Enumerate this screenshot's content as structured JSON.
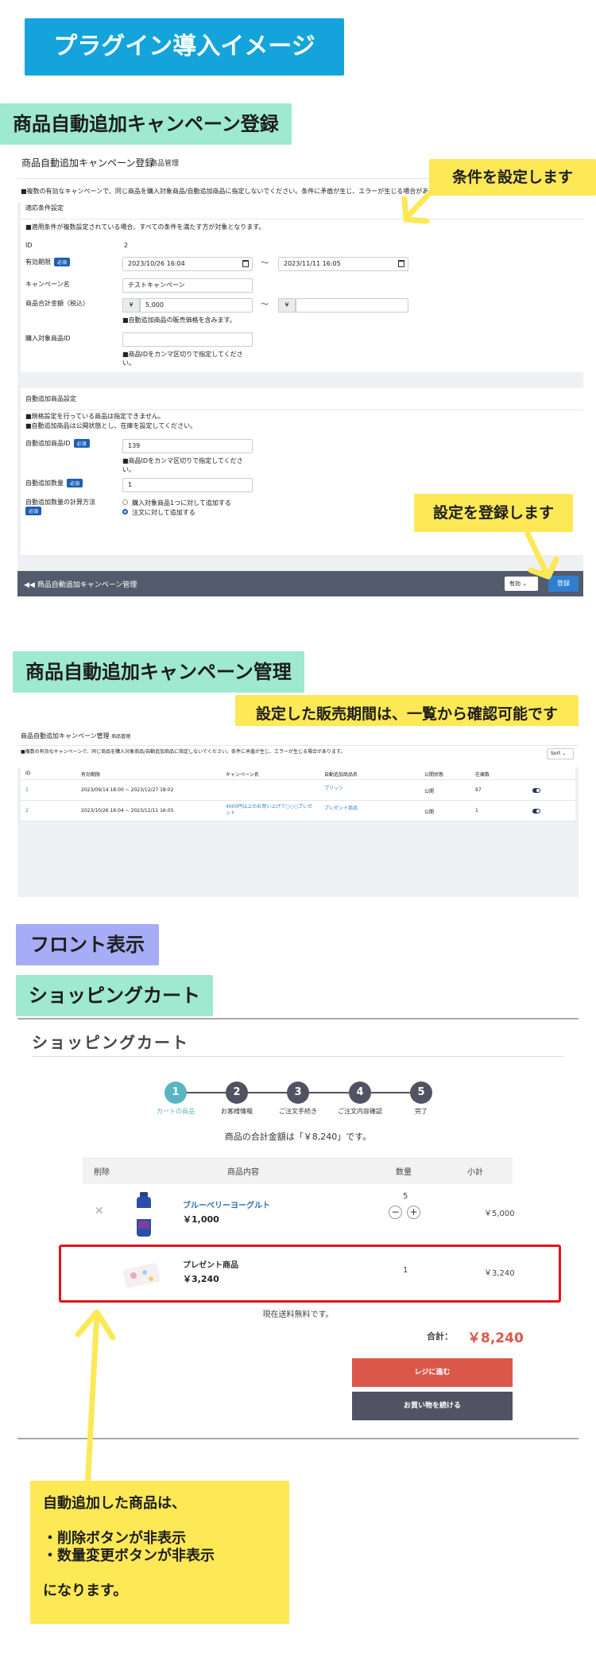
{
  "top_banner": "プラグイン導入イメージ",
  "section1": {
    "banner": "商品自動追加キャンペーン登録",
    "note_condition": "条件を設定します",
    "note_register": "設定を登録します",
    "admin": {
      "title": "商品自動追加キャンペーン登録",
      "subtitle": "商品管理",
      "warning": "■複数の有効なキャンペーンで、同じ商品を購入対象商品/自動追加商品に指定しないでください。条件に矛盾が生じ、エラーが生じる場合があります。",
      "panel1": {
        "title": "適応条件設定",
        "note": "■適用条件が複数設定されている場合、すべての条件を満たす方が対象となります。",
        "id_label": "ID",
        "id_value": "2",
        "period_label": "有効期限",
        "required": "必須",
        "period_start": "2023/10/26 16:04",
        "tilde": "〜",
        "period_end": "2023/11/11 16:05",
        "campaign_label": "キャンペーン名",
        "campaign_value": "テストキャンペーン",
        "total_label": "商品合計金額（税込）",
        "yen": "¥",
        "total_min": "5,000",
        "total_note": "■自動追加商品の販売価格を含みます。",
        "target_label": "購入対象商品ID",
        "target_note": "■商品IDをカンマ区切りで指定してくださ い。"
      },
      "panel2": {
        "title": "自動追加商品設定",
        "note1": "■規格設定を行っている商品は指定できません。",
        "note2": "■自動追加商品は公開状態とし、在庫を設定してください。",
        "product_id_label": "自動追加商品ID",
        "product_id_value": "139",
        "product_id_note": "■商品IDをカンマ区切りで指定してくださ い。",
        "qty_label": "自動追加数量",
        "qty_value": "1",
        "method_label": "自動追加数量の計算方法",
        "method_opt1": "購入対象商品1つに対して追加する",
        "method_opt2": "注文に対して追加する"
      },
      "footer": {
        "back_link": "◀◀ 商品自動追加キャンペーン管理",
        "status": "有効 ⌄",
        "register_btn": "登録"
      }
    }
  },
  "section2": {
    "banner": "商品自動追加キャンペーン管理",
    "note": "設定した販売期間は、一覧から確認可能です",
    "admin": {
      "title": "商品自動追加キャンペーン管理",
      "subtitle": "商品管理",
      "warning": "■複数の有効なキャンペーンで、同じ商品を購入対象商品/自動追加商品に指定しないでください。条件に矛盾が生じ、エラーが生じる場合があります。",
      "sort": "Sort ⌄",
      "headers": [
        "ID",
        "有効期限",
        "キャンペーン名",
        "自動追加商品名",
        "公開状態",
        "在庫数"
      ],
      "rows": [
        {
          "id": "1",
          "period": "2023/09/14 18:00 ~ 2023/12/27 18:02",
          "campaign": "",
          "product": "プリッツ",
          "status": "公開",
          "stock": "97"
        },
        {
          "id": "2",
          "period": "2023/10/26 16:04 ~ 2023/11/11 16:05",
          "campaign": "4000円以上のお買い上げで○○○プレゼント",
          "product": "プレゼント商品",
          "status": "公開",
          "stock": "1"
        }
      ]
    }
  },
  "section3": {
    "front_banner": "フロント表示",
    "cart_banner": "ショッピングカート",
    "cart": {
      "title": "ショッピングカート",
      "steps": [
        {
          "num": "1",
          "label": "カートの商品"
        },
        {
          "num": "2",
          "label": "お客様情報"
        },
        {
          "num": "3",
          "label": "ご注文手続き"
        },
        {
          "num": "4",
          "label": "ご注文内容確認"
        },
        {
          "num": "5",
          "label": "完了"
        }
      ],
      "total_message": "商品の合計金額は「￥8,240」です。",
      "headers": {
        "delete": "削除",
        "content": "商品内容",
        "qty": "数量",
        "subtotal": "小計"
      },
      "items": [
        {
          "name": "ブルーベリーヨーグルト",
          "price": "￥1,000",
          "qty": "5",
          "subtotal": "￥5,000"
        },
        {
          "name": "プレゼント商品",
          "price": "￥3,240",
          "qty": "1",
          "subtotal": "￥3,240"
        }
      ],
      "shipping_free": "現在送料無料です。",
      "total_label": "合計：",
      "total_value": "￥8,240",
      "checkout_btn": "レジに進む",
      "continue_btn": "お買い物を続ける"
    },
    "note_lines": [
      "自動追加した商品は、",
      "",
      "・削除ボタンが非表示",
      "・数量変更ボタンが非表示",
      "",
      "になります。"
    ]
  },
  "colors": {
    "top_banner": "#14a4db",
    "green_banner": "#9ee9d0",
    "purple_banner": "#a7acf7",
    "yellow_note": "#fde856",
    "highlight_red": "#e4141a",
    "checkout_btn": "#d9584a",
    "continue_btn": "#525263",
    "step_active": "#5ab5c0"
  }
}
